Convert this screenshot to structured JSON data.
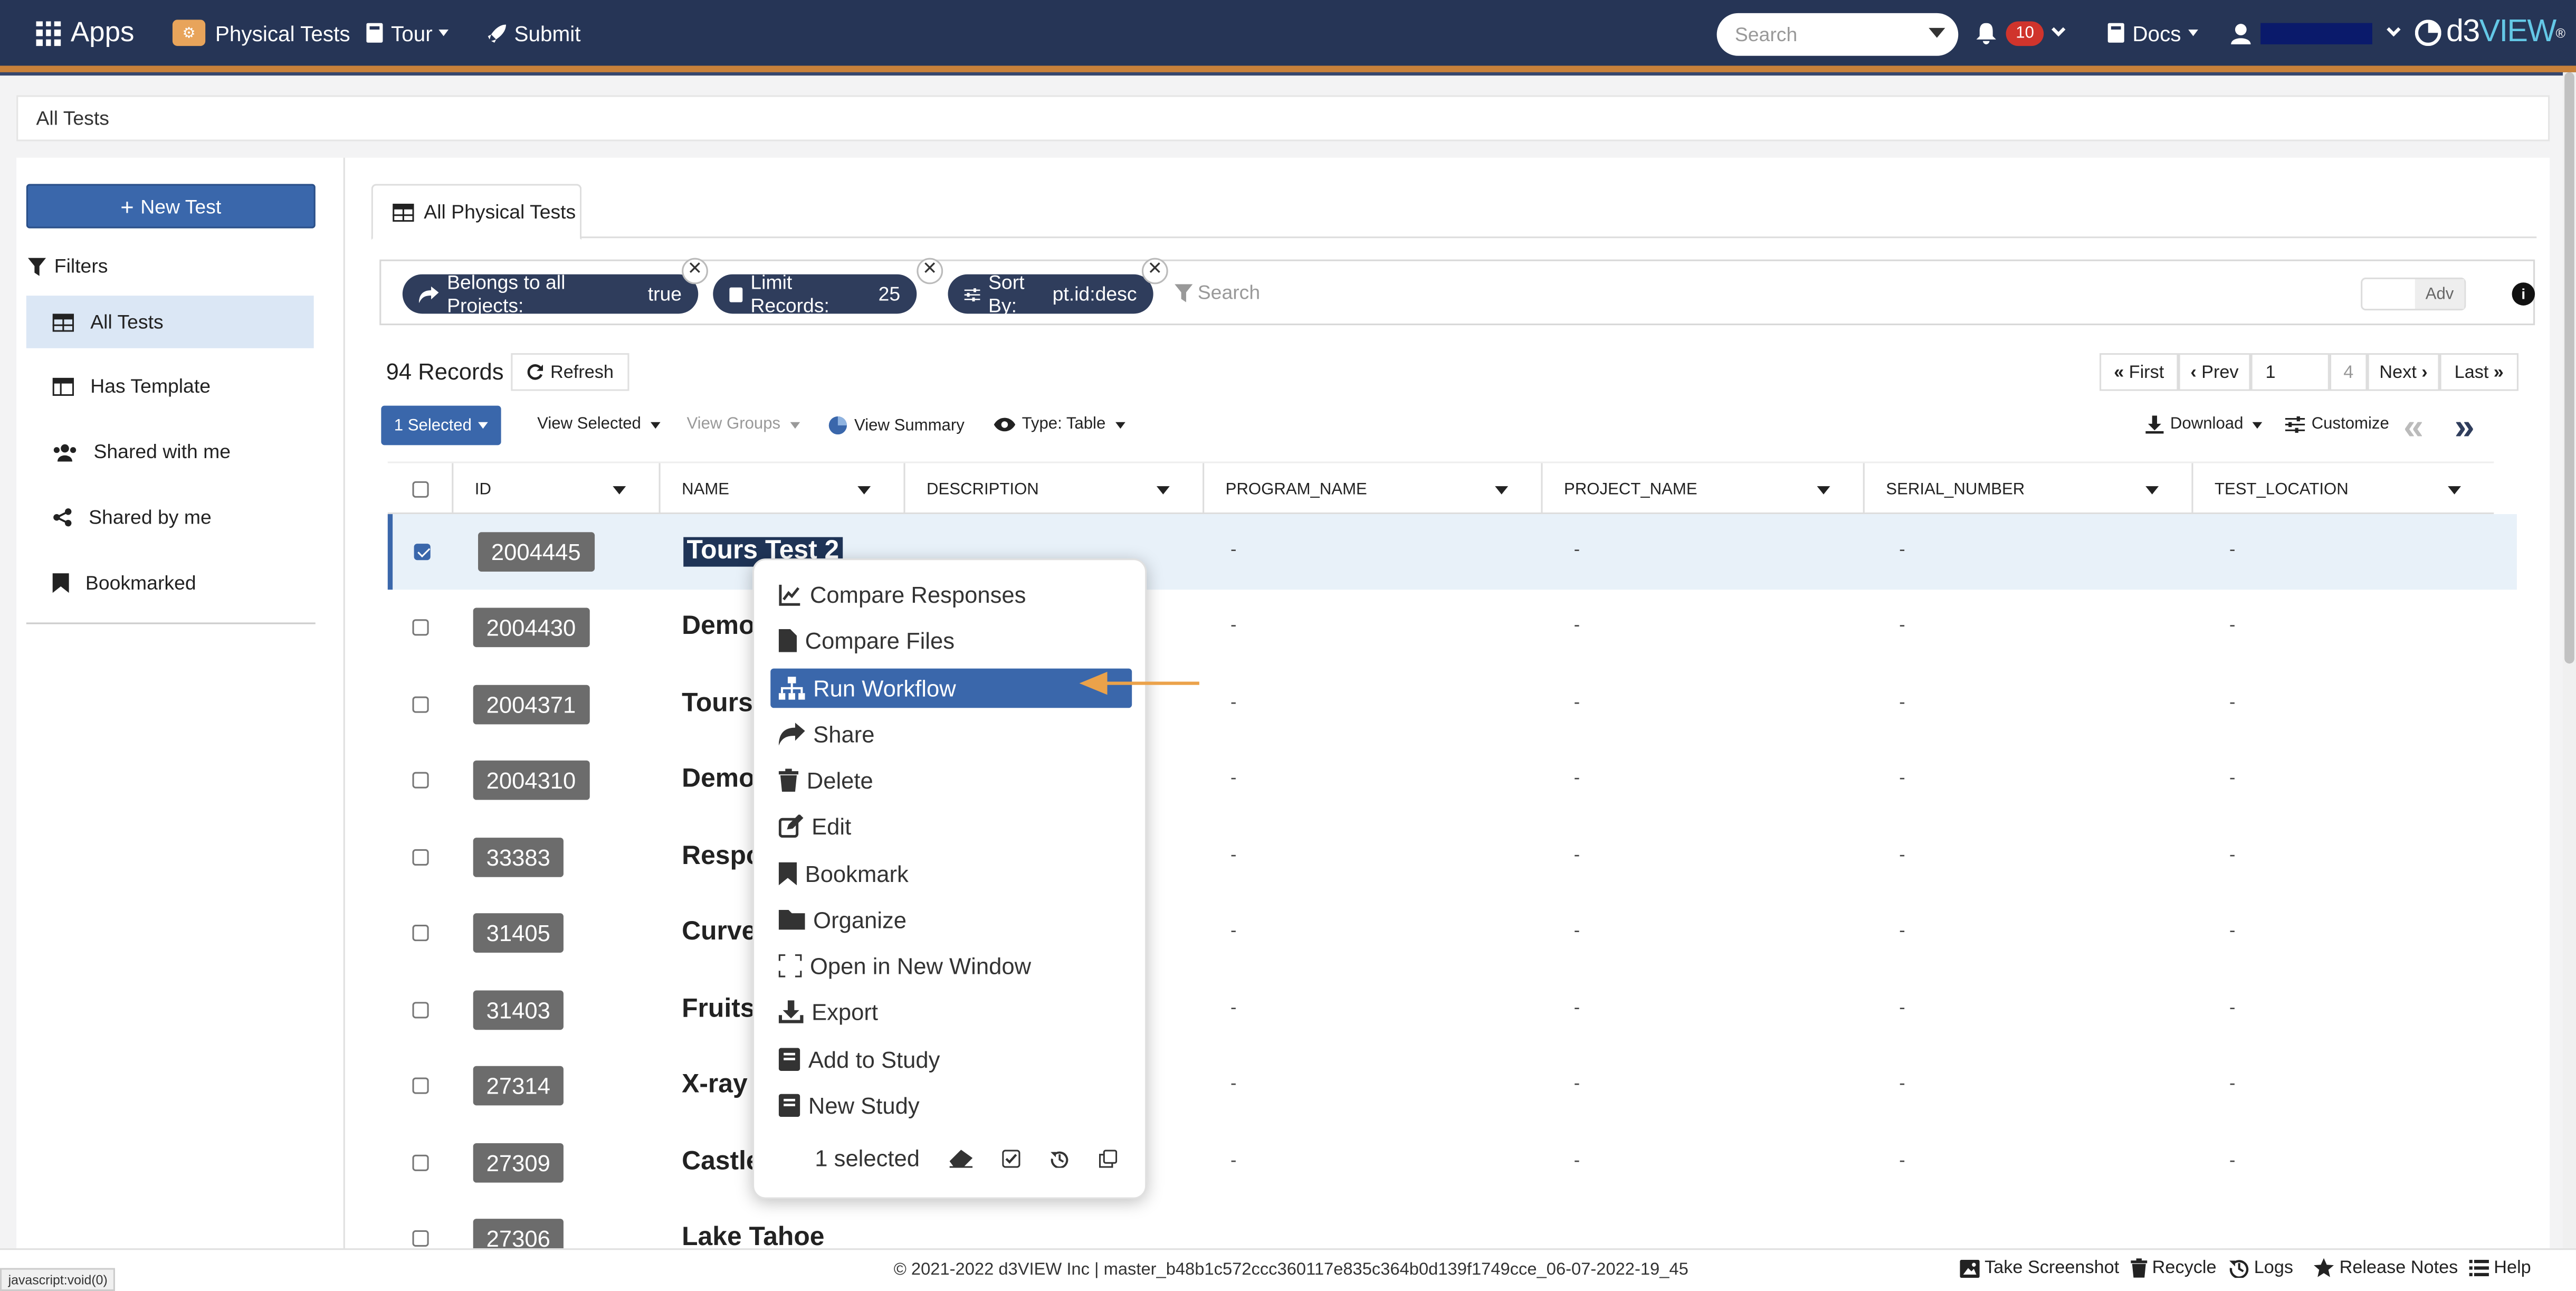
{
  "navbar": {
    "apps_label": "Apps",
    "physical_tests_label": "Physical Tests",
    "tour_label": "Tour",
    "submit_label": "Submit",
    "search_placeholder": "Search",
    "notification_count": "10",
    "docs_label": "Docs",
    "logo_d3": "d3",
    "logo_view": "VIEW",
    "logo_mark": "®"
  },
  "breadcrumb": {
    "label": "All Tests"
  },
  "sidebar": {
    "new_test_label": "New Test",
    "filters_label": "Filters",
    "items": [
      {
        "label": "All Tests",
        "icon": "table-icon"
      },
      {
        "label": "Has Template",
        "icon": "template-icon"
      },
      {
        "label": "Shared with me",
        "icon": "users-icon"
      },
      {
        "label": "Shared by me",
        "icon": "share-alt-icon"
      },
      {
        "label": "Bookmarked",
        "icon": "bookmark-icon"
      }
    ]
  },
  "main": {
    "tab_label": "All Physical Tests",
    "chips": [
      {
        "label": "Belongs to all Projects:",
        "value": "true"
      },
      {
        "label": "Limit Records:",
        "value": "25"
      },
      {
        "label": "Sort By:",
        "value": "pt.id:desc"
      }
    ],
    "filter_search_placeholder": "Search",
    "adv_label": "Adv",
    "records_label": "94 Records",
    "refresh_label": "Refresh",
    "pager": {
      "first": "First",
      "prev": "Prev",
      "page": "1",
      "total_pages": "4",
      "next": "Next",
      "last": "Last"
    },
    "toolbar": {
      "selected_label": "1 Selected",
      "view_selected": "View Selected",
      "view_groups": "View Groups",
      "view_summary": "View Summary",
      "type_table": "Type: Table",
      "download": "Download",
      "customize": "Customize"
    }
  },
  "table": {
    "columns": [
      "ID",
      "NAME",
      "DESCRIPTION",
      "PROGRAM_NAME",
      "PROJECT_NAME",
      "SERIAL_NUMBER",
      "TEST_LOCATION"
    ],
    "rows": [
      {
        "id": "2004445",
        "name": "Tours Test 2",
        "selected": true
      },
      {
        "id": "2004430",
        "name": "Demo"
      },
      {
        "id": "2004371",
        "name": "Tours"
      },
      {
        "id": "2004310",
        "name": "Demo"
      },
      {
        "id": "33383",
        "name": "Respo"
      },
      {
        "id": "31405",
        "name": "Curve"
      },
      {
        "id": "31403",
        "name": "Fruits"
      },
      {
        "id": "27314",
        "name": "X-ray"
      },
      {
        "id": "27309",
        "name": "Castle"
      },
      {
        "id": "27306",
        "name": "Lake Tahoe"
      }
    ],
    "empty_value": "-"
  },
  "context_menu": {
    "items": [
      {
        "label": "Compare Responses",
        "icon": "line-chart-icon"
      },
      {
        "label": "Compare Files",
        "icon": "file-icon"
      },
      {
        "label": "Run Workflow",
        "icon": "sitemap-icon",
        "active": true
      },
      {
        "label": "Share",
        "icon": "share-icon"
      },
      {
        "label": "Delete",
        "icon": "trash-icon"
      },
      {
        "label": "Edit",
        "icon": "edit-icon"
      },
      {
        "label": "Bookmark",
        "icon": "bookmark-icon"
      },
      {
        "label": "Organize",
        "icon": "folder-icon"
      },
      {
        "label": "Open in New Window",
        "icon": "expand-icon"
      },
      {
        "label": "Export",
        "icon": "download-icon"
      },
      {
        "label": "Add to Study",
        "icon": "book-icon"
      },
      {
        "label": "New Study",
        "icon": "book-icon"
      }
    ],
    "selected_count_label": "1 selected"
  },
  "footer": {
    "copyright": "© 2021-2022 d3VIEW Inc | master_b48b1c572ccc360117e835c364b0d139f1749cce_06-07-2022-19_45",
    "take_screenshot": "Take Screenshot",
    "recycle": "Recycle",
    "logs": "Logs",
    "release_notes": "Release Notes",
    "help": "Help"
  },
  "status_bar": {
    "url": "javascript:void(0)"
  },
  "colors": {
    "navbar_bg": "#263556",
    "accent_orange": "#c8813a",
    "primary_blue": "#3a67ab",
    "chip_bg": "#2f3d5c",
    "id_badge_bg": "#6c6c6c",
    "annotation_arrow": "#eba24a"
  }
}
